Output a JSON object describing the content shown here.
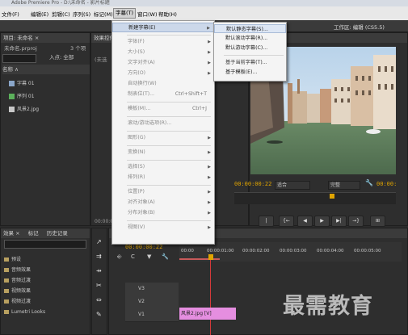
{
  "title_bar": "Adobe Premiere Pro - D:\\未命名 - 影片标题",
  "menu": [
    "文件(F)",
    "编辑(E)",
    "剪辑(C)",
    "序列(S)",
    "标记(M)",
    "字幕(T)",
    "窗口(W)",
    "帮助(H)"
  ],
  "workspace": "工作区: 编辑 (CS5.5)",
  "project": {
    "tab": "项目: 未命名 ×",
    "file": "未命名.prproj",
    "count": "3 个项",
    "in_label": "入点: 全部",
    "col_name": "名称 ∧",
    "items": [
      "字幕 01",
      "序列 01",
      "风景2.jpg"
    ]
  },
  "source_tab": "效果控件",
  "source_hint": "(未选",
  "source_timecode": "00:00:00",
  "program": {
    "timecode": "00:00:00:22",
    "fit": "适合",
    "full": "完整",
    "right_timecode": "00:00:",
    "buttons": [
      "|",
      "{←",
      "◀",
      "▶",
      "▶|",
      "→}",
      "⊞"
    ]
  },
  "title_menu": [
    {
      "label": "新建字幕(E)",
      "arrow": true,
      "state": "highlight"
    },
    {
      "sep": true
    },
    {
      "label": "字体(F)",
      "arrow": true
    },
    {
      "label": "大小(S)",
      "arrow": true
    },
    {
      "label": "文字对齐(A)",
      "arrow": true
    },
    {
      "label": "方向(O)",
      "arrow": true
    },
    {
      "label": "自动换行(W)"
    },
    {
      "label": "制表位(T)...",
      "shortcut": "Ctrl+Shift+T"
    },
    {
      "sep": true
    },
    {
      "label": "模板(M)...",
      "shortcut": "Ctrl+J"
    },
    {
      "sep": true
    },
    {
      "label": "滚动/游动选项(R)..."
    },
    {
      "sep": true
    },
    {
      "label": "图形(G)",
      "arrow": true
    },
    {
      "sep": true
    },
    {
      "label": "变换(N)",
      "arrow": true
    },
    {
      "sep": true
    },
    {
      "label": "选择(S)",
      "arrow": true
    },
    {
      "label": "排列(R)",
      "arrow": true
    },
    {
      "sep": true
    },
    {
      "label": "位置(P)",
      "arrow": true
    },
    {
      "label": "对齐对象(A)",
      "arrow": true
    },
    {
      "label": "分布对象(B)",
      "arrow": true
    },
    {
      "sep": true
    },
    {
      "label": "视图(V)",
      "arrow": true
    }
  ],
  "submenu": [
    {
      "label": "默认静态字幕(S)...",
      "state": "highlight"
    },
    {
      "label": "默认滚动字幕(R)..."
    },
    {
      "label": "默认游动字幕(C)..."
    },
    {
      "sep": true
    },
    {
      "label": "基于当前字幕(T)..."
    },
    {
      "label": "基于模板(E)..."
    }
  ],
  "effects": {
    "tabs": [
      "效果 ×",
      "标记",
      "历史记录"
    ],
    "folders": [
      "预设",
      "音频效果",
      "音频过渡",
      "视频效果",
      "视频过渡",
      "Lumetri Looks"
    ]
  },
  "timeline": {
    "timecode": "00:00:00:22",
    "ruler": [
      "00:00",
      "00:00:01:00",
      "00:00:02:00",
      "00:00:03:00",
      "00:00:04:00",
      "00:00:05:00"
    ],
    "tracks": [
      "V3",
      "V2",
      "V1"
    ],
    "clip": "风景2.jpg [V]"
  },
  "watermark": "最需教育",
  "colors": {
    "accent": "#e0a400",
    "clip": "#e58ee0",
    "menu_bg": "#f4f4f4",
    "highlight": "#ccd8ea"
  }
}
